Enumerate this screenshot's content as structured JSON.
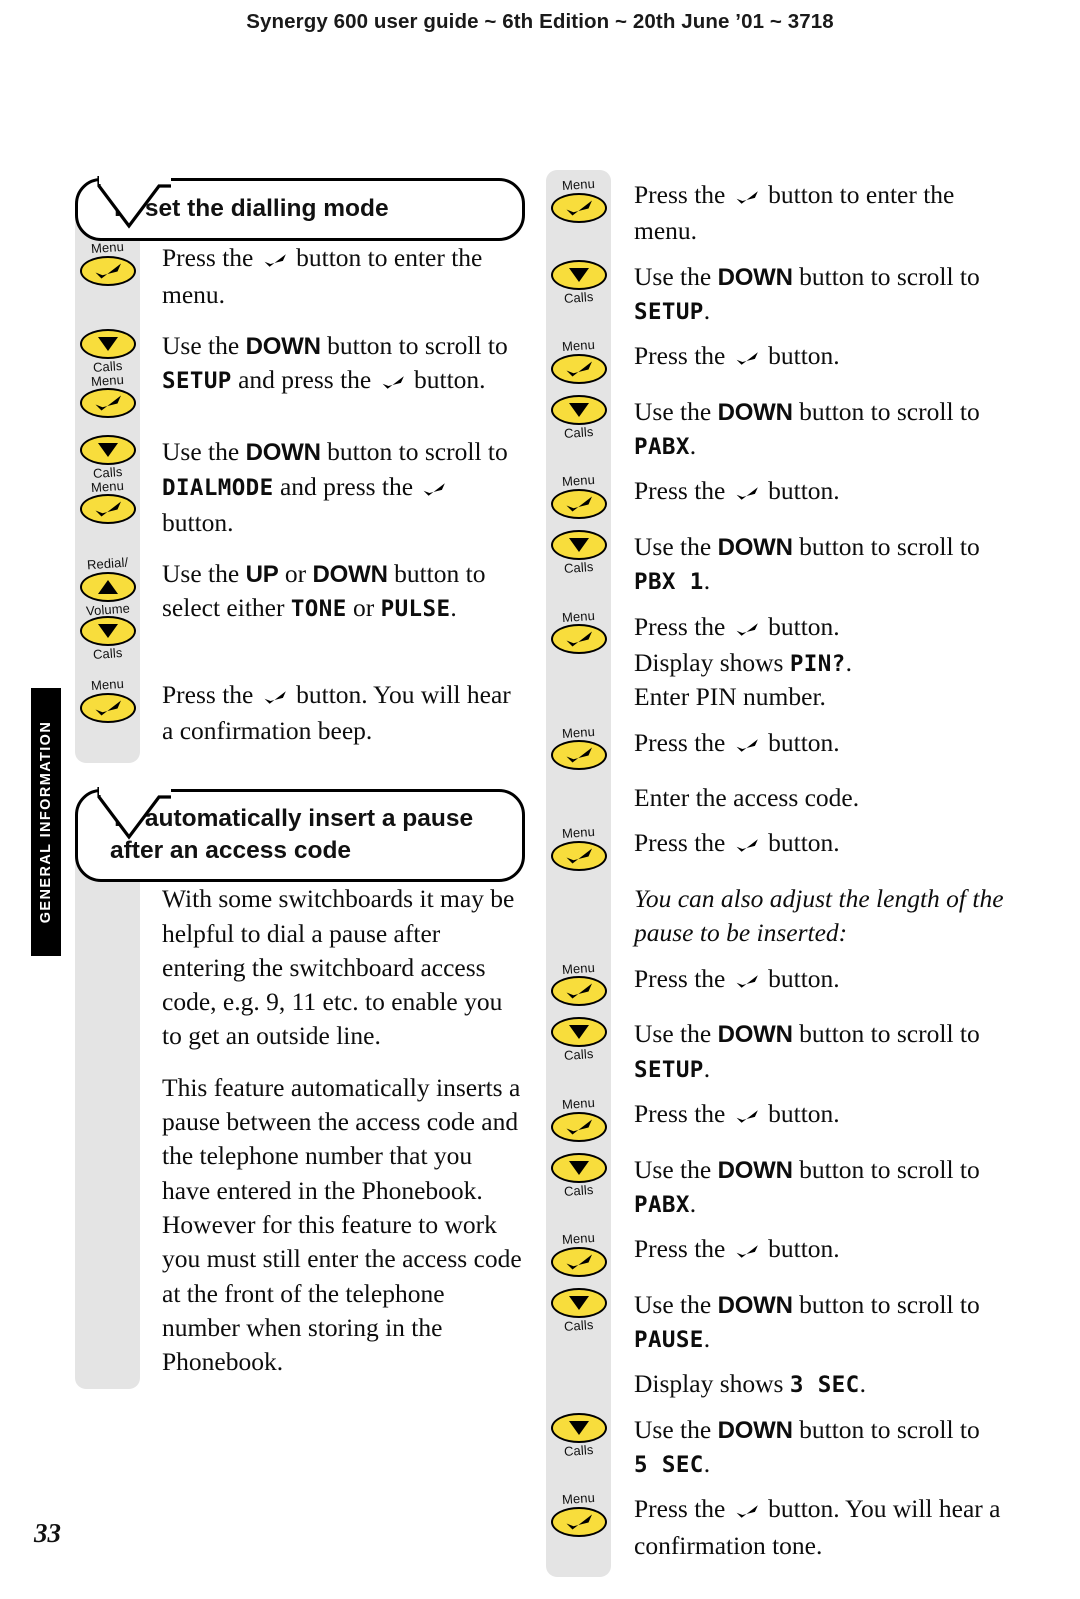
{
  "header": {
    "running_head": "Synergy 600 user guide ~ 6th Edition ~ 20th June ’01 ~ 3718"
  },
  "side_tab": {
    "label": "GENERAL INFORMATION"
  },
  "page_number": "33",
  "icons": {
    "tick": "tick-button-icon",
    "down": "down-arrow-button-icon",
    "up": "up-arrow-button-icon"
  },
  "key_captions": {
    "menu": "Menu",
    "calls": "Calls",
    "redial": "Redial/",
    "volume": "Volume"
  },
  "left_column": {
    "heading_1": "To set the dialling mode",
    "steps": [
      {
        "keys": [
          {
            "type": "tick",
            "above": "Menu",
            "below": ""
          }
        ],
        "text_parts": [
          {
            "t": "Press the "
          },
          {
            "glyph": "tick"
          },
          {
            "t": " button to enter the menu."
          }
        ]
      },
      {
        "keys": [
          {
            "type": "down",
            "above": "",
            "below": "Calls"
          },
          {
            "type": "tick",
            "above": "Menu",
            "below": ""
          }
        ],
        "text_parts": [
          {
            "t": "Use the "
          },
          {
            "bold": "DOWN"
          },
          {
            "t": " button to scroll to "
          },
          {
            "lcd": "SETUP"
          },
          {
            "t": " and press the "
          },
          {
            "glyph": "tick"
          },
          {
            "t": " button."
          }
        ]
      },
      {
        "keys": [
          {
            "type": "down",
            "above": "",
            "below": "Calls"
          },
          {
            "type": "tick",
            "above": "Menu",
            "below": ""
          }
        ],
        "text_parts": [
          {
            "t": "Use the "
          },
          {
            "bold": "DOWN"
          },
          {
            "t": " button to scroll to "
          },
          {
            "lcd": "DIALMODE"
          },
          {
            "t": " and press the "
          },
          {
            "glyph": "tick"
          },
          {
            "t": " button."
          }
        ]
      },
      {
        "keys": [
          {
            "type": "up",
            "above": "Redial/",
            "below": "Volume"
          },
          {
            "type": "down",
            "above": "",
            "below": "Calls"
          }
        ],
        "text_parts": [
          {
            "t": "Use the "
          },
          {
            "bold": "UP"
          },
          {
            "t": " or "
          },
          {
            "bold": "DOWN"
          },
          {
            "t": " button to select either "
          },
          {
            "lcd": "TONE"
          },
          {
            "t": " or "
          },
          {
            "lcd": "PULSE"
          },
          {
            "t": "."
          }
        ]
      },
      {
        "keys": [
          {
            "type": "tick",
            "above": "Menu",
            "below": ""
          }
        ],
        "text_parts": [
          {
            "t": "Press the "
          },
          {
            "glyph": "tick"
          },
          {
            "t": " button. You will hear a confirmation beep."
          }
        ]
      }
    ],
    "heading_2_line_1": "To automatically insert a pause",
    "heading_2_line_2": "after an access code",
    "paragraphs": [
      "With some switchboards it may be helpful to dial a pause after entering the switchboard access code, e.g. 9, 11 etc. to enable you to get an outside line.",
      "This feature automatically inserts a pause between the access code and the telephone number that you have entered in the Phonebook. However for this feature to work you must still enter the access code at the front of the telephone number when storing in the Phonebook."
    ]
  },
  "right_column": {
    "steps": [
      {
        "keys": [
          {
            "type": "tick",
            "above": "Menu",
            "below": ""
          }
        ],
        "text_parts": [
          {
            "t": "Press the "
          },
          {
            "glyph": "tick"
          },
          {
            "t": " button to enter the menu."
          }
        ]
      },
      {
        "keys": [
          {
            "type": "down",
            "above": "",
            "below": "Calls"
          }
        ],
        "text_parts": [
          {
            "t": "Use the "
          },
          {
            "bold": "DOWN"
          },
          {
            "t": " button to scroll to "
          },
          {
            "lcd": "SETUP"
          },
          {
            "t": "."
          }
        ]
      },
      {
        "keys": [
          {
            "type": "tick",
            "above": "Menu",
            "below": ""
          }
        ],
        "text_parts": [
          {
            "t": "Press the "
          },
          {
            "glyph": "tick"
          },
          {
            "t": " button."
          }
        ]
      },
      {
        "keys": [
          {
            "type": "down",
            "above": "",
            "below": "Calls"
          }
        ],
        "text_parts": [
          {
            "t": "Use the "
          },
          {
            "bold": "DOWN"
          },
          {
            "t": " button to scroll to "
          },
          {
            "lcd": "PABX"
          },
          {
            "t": "."
          }
        ]
      },
      {
        "keys": [
          {
            "type": "tick",
            "above": "Menu",
            "below": ""
          }
        ],
        "text_parts": [
          {
            "t": "Press the "
          },
          {
            "glyph": "tick"
          },
          {
            "t": " button."
          }
        ]
      },
      {
        "keys": [
          {
            "type": "down",
            "above": "",
            "below": "Calls"
          }
        ],
        "text_parts": [
          {
            "t": "Use the "
          },
          {
            "bold": "DOWN"
          },
          {
            "t": " button to scroll to "
          },
          {
            "lcd": "PBX 1"
          },
          {
            "t": "."
          }
        ]
      },
      {
        "keys": [
          {
            "type": "tick",
            "above": "Menu",
            "below": ""
          }
        ],
        "text_parts": [
          {
            "t": "Press the "
          },
          {
            "glyph": "tick"
          },
          {
            "t": " button."
          },
          {
            "br": true
          },
          {
            "t": "Display shows "
          },
          {
            "lcd": "PIN?"
          },
          {
            "t": "."
          },
          {
            "br": true
          },
          {
            "t": "Enter PIN number."
          }
        ]
      },
      {
        "keys": [
          {
            "type": "tick",
            "above": "Menu",
            "below": ""
          }
        ],
        "text_parts": [
          {
            "t": "Press the "
          },
          {
            "glyph": "tick"
          },
          {
            "t": " button."
          }
        ]
      },
      {
        "keys": [],
        "text_parts": [
          {
            "t": "Enter the access code."
          }
        ]
      },
      {
        "keys": [
          {
            "type": "tick",
            "above": "Menu",
            "below": ""
          }
        ],
        "text_parts": [
          {
            "t": "Press the "
          },
          {
            "glyph": "tick"
          },
          {
            "t": " button."
          }
        ]
      },
      {
        "keys": [],
        "italic": true,
        "text_parts": [
          {
            "t": "You can also adjust the length of the pause to be inserted:"
          }
        ]
      },
      {
        "keys": [
          {
            "type": "tick",
            "above": "Menu",
            "below": ""
          }
        ],
        "text_parts": [
          {
            "t": "Press the "
          },
          {
            "glyph": "tick"
          },
          {
            "t": " button."
          }
        ]
      },
      {
        "keys": [
          {
            "type": "down",
            "above": "",
            "below": "Calls"
          }
        ],
        "text_parts": [
          {
            "t": "Use the "
          },
          {
            "bold": "DOWN"
          },
          {
            "t": " button to scroll to "
          },
          {
            "lcd": "SETUP"
          },
          {
            "t": "."
          }
        ]
      },
      {
        "keys": [
          {
            "type": "tick",
            "above": "Menu",
            "below": ""
          }
        ],
        "text_parts": [
          {
            "t": "Press the "
          },
          {
            "glyph": "tick"
          },
          {
            "t": " button."
          }
        ]
      },
      {
        "keys": [
          {
            "type": "down",
            "above": "",
            "below": "Calls"
          }
        ],
        "text_parts": [
          {
            "t": "Use the "
          },
          {
            "bold": "DOWN"
          },
          {
            "t": " button to scroll to "
          },
          {
            "lcd": "PABX"
          },
          {
            "t": "."
          }
        ]
      },
      {
        "keys": [
          {
            "type": "tick",
            "above": "Menu",
            "below": ""
          }
        ],
        "text_parts": [
          {
            "t": "Press the "
          },
          {
            "glyph": "tick"
          },
          {
            "t": " button."
          }
        ]
      },
      {
        "keys": [
          {
            "type": "down",
            "above": "",
            "below": "Calls"
          }
        ],
        "text_parts": [
          {
            "t": "Use the "
          },
          {
            "bold": "DOWN"
          },
          {
            "t": " button to scroll to "
          },
          {
            "lcd": "PAUSE"
          },
          {
            "t": "."
          }
        ]
      },
      {
        "keys": [],
        "text_parts": [
          {
            "t": "Display shows "
          },
          {
            "lcd": "3 SEC"
          },
          {
            "t": "."
          }
        ]
      },
      {
        "keys": [
          {
            "type": "down",
            "above": "",
            "below": "Calls"
          }
        ],
        "text_parts": [
          {
            "t": "Use the "
          },
          {
            "bold": "DOWN"
          },
          {
            "t": " button to scroll to "
          },
          {
            "lcd": "5 SEC"
          },
          {
            "t": "."
          }
        ]
      },
      {
        "keys": [
          {
            "type": "tick",
            "above": "Menu",
            "below": ""
          }
        ],
        "text_parts": [
          {
            "t": "Press the "
          },
          {
            "glyph": "tick"
          },
          {
            "t": " button. You will hear a confirmation tone."
          }
        ]
      }
    ]
  },
  "colors": {
    "key_yellow": "#F8DD3C",
    "rail_grey": "#e4e4e4",
    "tab_black": "#000000"
  }
}
